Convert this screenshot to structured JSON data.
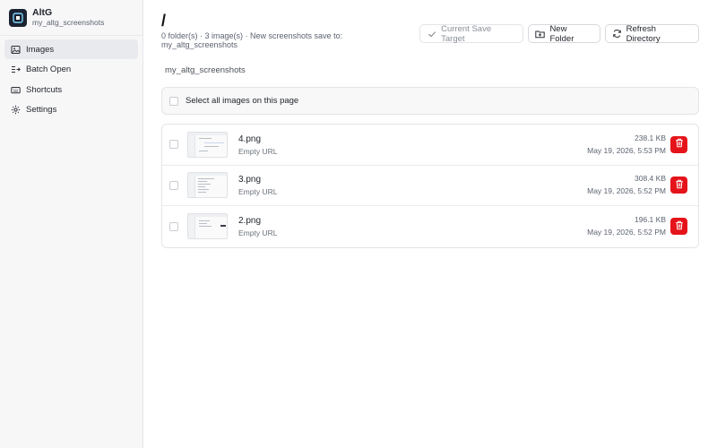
{
  "app": {
    "name": "AltG",
    "subtitle": "my_altg_screenshots"
  },
  "sidebar": {
    "items": [
      {
        "label": "Images",
        "icon": "image-icon",
        "active": true
      },
      {
        "label": "Batch Open",
        "icon": "batch-open-icon",
        "active": false
      },
      {
        "label": "Shortcuts",
        "icon": "keyboard-icon",
        "active": false
      },
      {
        "label": "Settings",
        "icon": "gear-icon",
        "active": false
      }
    ]
  },
  "header": {
    "path": "/",
    "summary": "0 folder(s) · 3 image(s) · New screenshots save to: my_altg_screenshots",
    "buttons": {
      "current_save_target": "Current Save Target",
      "new_folder": "New Folder",
      "refresh_directory": "Refresh Directory"
    }
  },
  "breadcrumb": "my_altg_screenshots",
  "select_all_label": "Select all images on this page",
  "files": [
    {
      "name": "4.png",
      "url": "Empty URL",
      "size": "238.1 KB",
      "date": "May 19, 2026, 5:53 PM"
    },
    {
      "name": "3.png",
      "url": "Empty URL",
      "size": "308.4 KB",
      "date": "May 19, 2026, 5:52 PM"
    },
    {
      "name": "2.png",
      "url": "Empty URL",
      "size": "196.1 KB",
      "date": "May 19, 2026, 5:52 PM"
    }
  ],
  "colors": {
    "accent_delete": "#e5141a",
    "sidebar_bg": "#f7f7f8",
    "logo_bg": "#1b2230"
  }
}
